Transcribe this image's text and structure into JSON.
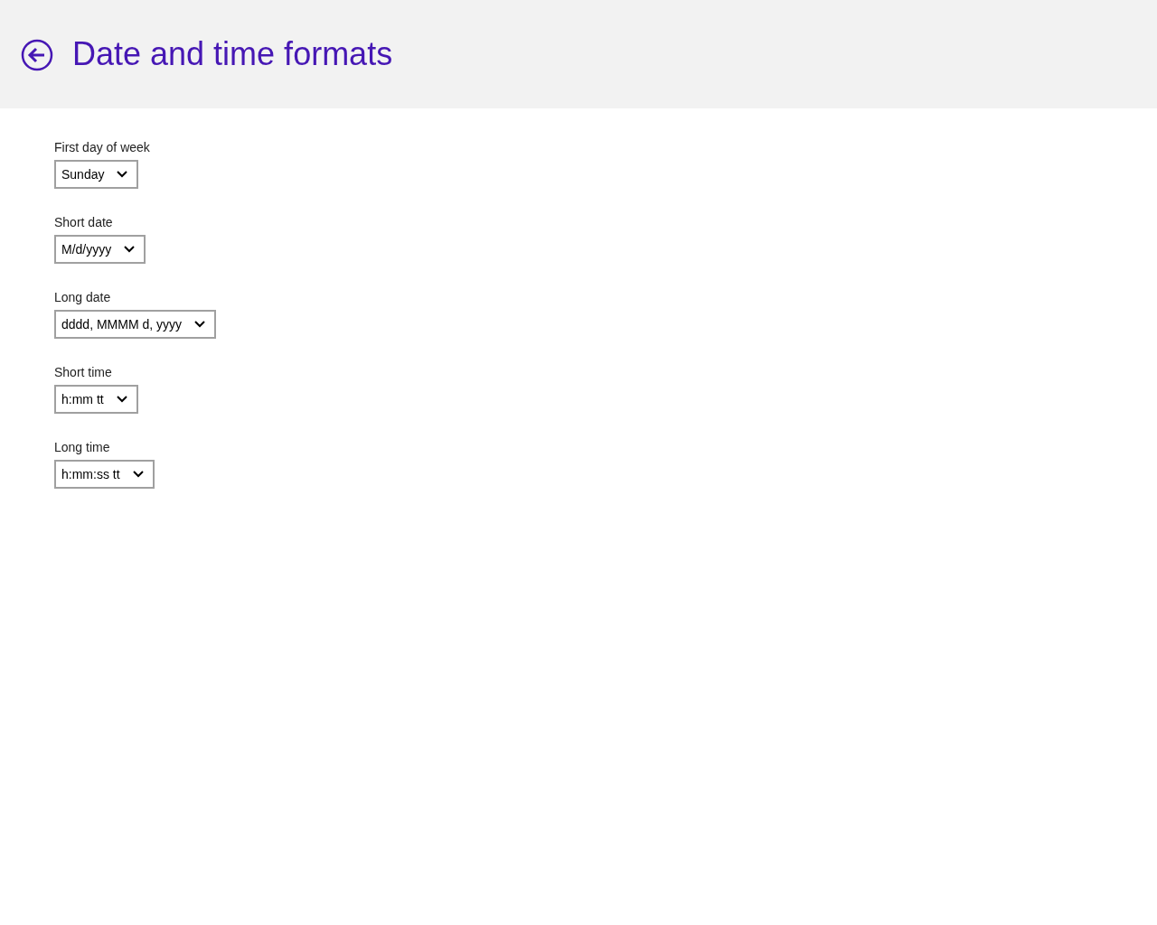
{
  "header": {
    "title": "Date and time formats"
  },
  "settings": [
    {
      "label": "First day of week",
      "value": "Sunday"
    },
    {
      "label": "Short date",
      "value": "M/d/yyyy"
    },
    {
      "label": "Long date",
      "value": "dddd, MMMM d, yyyy"
    },
    {
      "label": "Short time",
      "value": "h:mm tt"
    },
    {
      "label": "Long time",
      "value": "h:mm:ss tt"
    }
  ]
}
